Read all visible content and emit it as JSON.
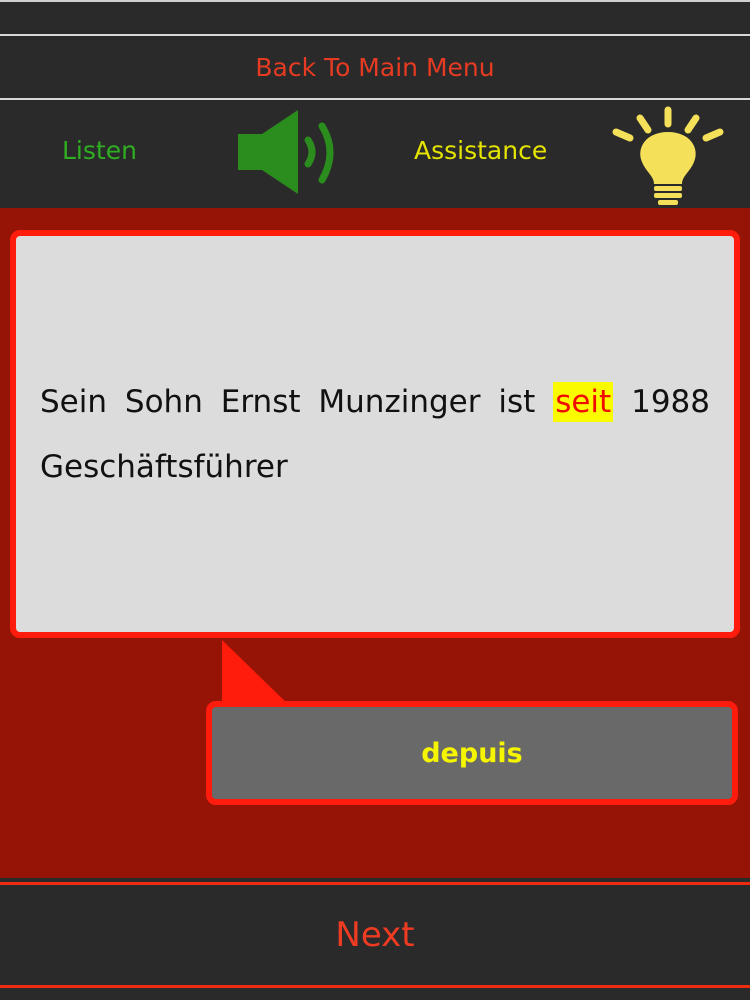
{
  "menu": {
    "back_label": "Back To Main Menu"
  },
  "toolbar": {
    "listen_label": "Listen",
    "assistance_label": "Assistance",
    "listen_icon": "speaker-icon",
    "assistance_icon": "lightbulb-icon"
  },
  "exercise": {
    "sentence_before": "Sein Sohn Ernst Munzinger ist ",
    "highlighted_word": "seit",
    "sentence_after": " 1988 Geschäftsführer",
    "translation": "depuis"
  },
  "footer": {
    "next_label": "Next"
  },
  "colors": {
    "background": "#2a2a2a",
    "main_panel": "#951405",
    "accent_red": "#ff1c0c",
    "listen_green": "#2fae22",
    "assistance_yellow": "#e4e400",
    "highlight_yellow": "#fbfb00"
  }
}
